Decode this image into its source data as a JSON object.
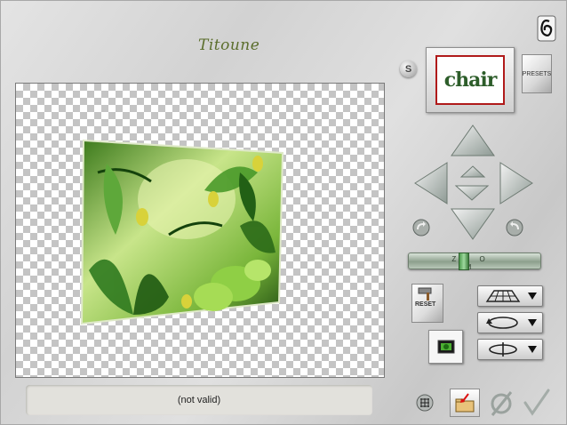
{
  "header": {
    "title": "Titoune"
  },
  "preview": {
    "text": "chair",
    "s_label": "S",
    "presets_label": "PRESETS"
  },
  "slider": {
    "label": "Z O M"
  },
  "reset": {
    "label": "RESET"
  },
  "status": {
    "text": "(not valid)"
  },
  "icons": {
    "logo": "paperclip-logo-icon",
    "nav": [
      "arrow-up-icon",
      "arrow-left-icon",
      "arrow-right-icon",
      "arrow-down-icon",
      "arrow-forward-icon",
      "arrow-back-icon",
      "rotate-left-icon",
      "rotate-right-icon"
    ],
    "modes": [
      "perspective-grid-icon",
      "rotate-ellipse-icon",
      "flip-around-icon"
    ],
    "bottom": [
      "grid-icon",
      "open-folder-icon",
      "cancel-icon",
      "ok-check-icon"
    ]
  },
  "colors": {
    "title": "#5b6e2c",
    "preview_border": "#b01a1a",
    "leaf_green": "#5ea83a",
    "slider_green": "#8da08d"
  }
}
